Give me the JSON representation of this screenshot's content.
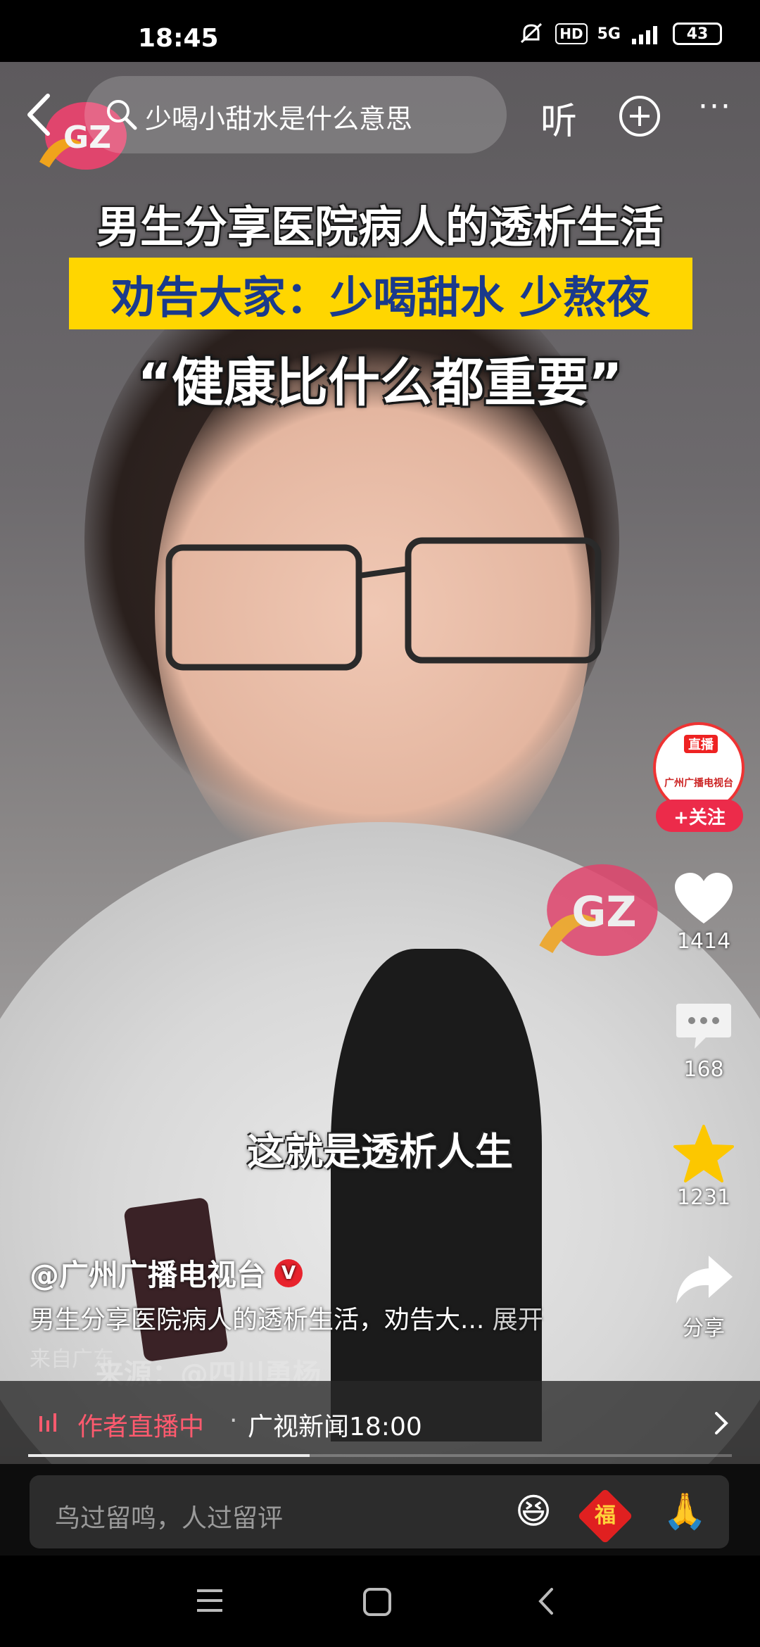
{
  "status_bar": {
    "time": "18:45",
    "hd": "HD",
    "network": "5G",
    "battery": "43"
  },
  "top_nav": {
    "search_text": "少喝小甜水是什么意思",
    "listen_label": "听",
    "more_label": "···"
  },
  "video": {
    "logo_text": "GZ",
    "headline": "男生分享医院病人的透析生活",
    "subheadline": "劝告大家：少喝甜水 少熬夜",
    "quote": "“健康比什么都重要”",
    "subtitle": "这就是透析人生",
    "source_watermark": "来源：@四川勇杨"
  },
  "right_rail": {
    "avatar_live_label": "直播",
    "avatar_name": "广州广播电视台",
    "follow_label": "+关注",
    "likes": "1414",
    "comments": "168",
    "favorites": "1231",
    "share_label": "分享"
  },
  "post": {
    "author": "@广州广播电视台",
    "verified_mark": "V",
    "description": "男生分享医院病人的透析生活，劝告大...",
    "expand_label": "展开",
    "location": "来自广东"
  },
  "live_bar": {
    "status": "作者直播中",
    "separator": "·",
    "program": "广视新闻18:00"
  },
  "progress": {
    "fraction": 0.4
  },
  "comment": {
    "placeholder": "鸟过留鸣，人过留评",
    "emojis": [
      "😆",
      "福",
      "🙏"
    ]
  },
  "colors": {
    "accent_red": "#ec2b4a",
    "banner_yellow": "#ffd600",
    "banner_text": "#1a3a8c"
  }
}
